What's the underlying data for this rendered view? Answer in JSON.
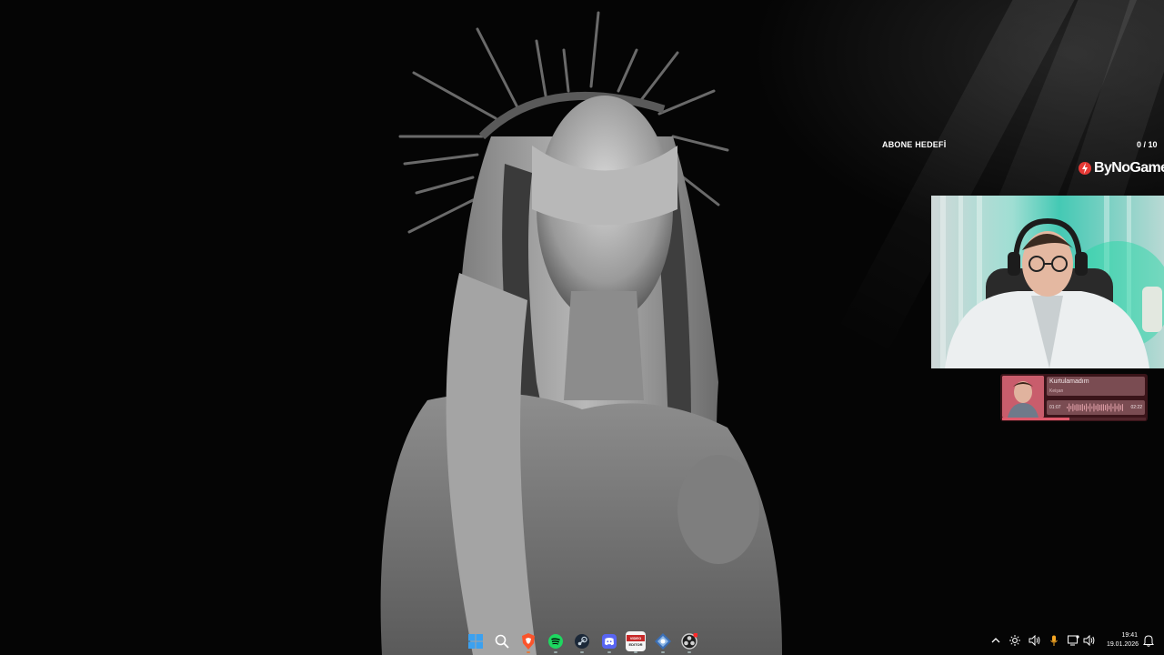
{
  "subscriber_goal": {
    "title": "ABONE HEDEFİ",
    "count": "0 / 10"
  },
  "brand": {
    "name": "ByNoGame",
    "accent": "#e53935"
  },
  "now_playing": {
    "title": "Kurtulamadım",
    "artist": "Keişan",
    "current_time": "01:07",
    "total_time": "02:22",
    "progress": 0.47,
    "colors": {
      "card": "#3a1419",
      "panel": "#7a4c52",
      "accent": "#e05a6c"
    }
  },
  "taskbar": {
    "apps": [
      {
        "name": "windows-start-icon"
      },
      {
        "name": "search-icon"
      },
      {
        "name": "brave-browser-icon"
      },
      {
        "name": "spotify-icon"
      },
      {
        "name": "steam-icon"
      },
      {
        "name": "discord-icon"
      },
      {
        "name": "video-editor-icon",
        "label": "VIDEO EDITOR"
      },
      {
        "name": "network-app-icon"
      },
      {
        "name": "obs-icon"
      }
    ],
    "tray": [
      "chevron-up-icon",
      "brightness-icon",
      "volume-icon",
      "microphone-icon",
      "display-icon",
      "speaker-icon"
    ],
    "clock": {
      "time": "19:41",
      "date": "19.01.2026"
    }
  }
}
